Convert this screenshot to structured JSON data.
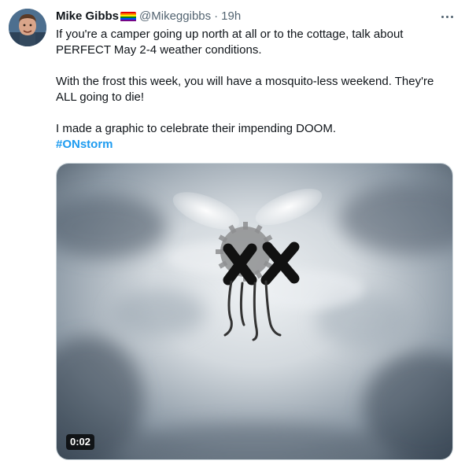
{
  "tweet": {
    "author_name": "Mike Gibbs",
    "handle": "@Mikeggibbs",
    "separator": "·",
    "time": "19h",
    "icons": {
      "avatar": "profile-photo",
      "flag": "rainbow-flag-icon",
      "more": "more-horizontal-icon"
    },
    "text": {
      "line1": "If you're a camper going up north at all or to the cottage, talk about PERFECT May 2-4 weather conditions.",
      "line2": "With the frost this week, you will have a mosquito-less weekend. They're ALL going to die!",
      "line3": "I made a graphic to celebrate their impending DOOM.",
      "hashtag": "#ONstorm"
    },
    "media": {
      "type": "video",
      "duration": "0:02"
    }
  },
  "colors": {
    "text": "#0f1419",
    "secondary": "#536471",
    "link": "#1d9bf0",
    "flag_stripes": [
      "#e40303",
      "#ff8c00",
      "#ffed00",
      "#008026",
      "#004dff",
      "#750787"
    ]
  }
}
